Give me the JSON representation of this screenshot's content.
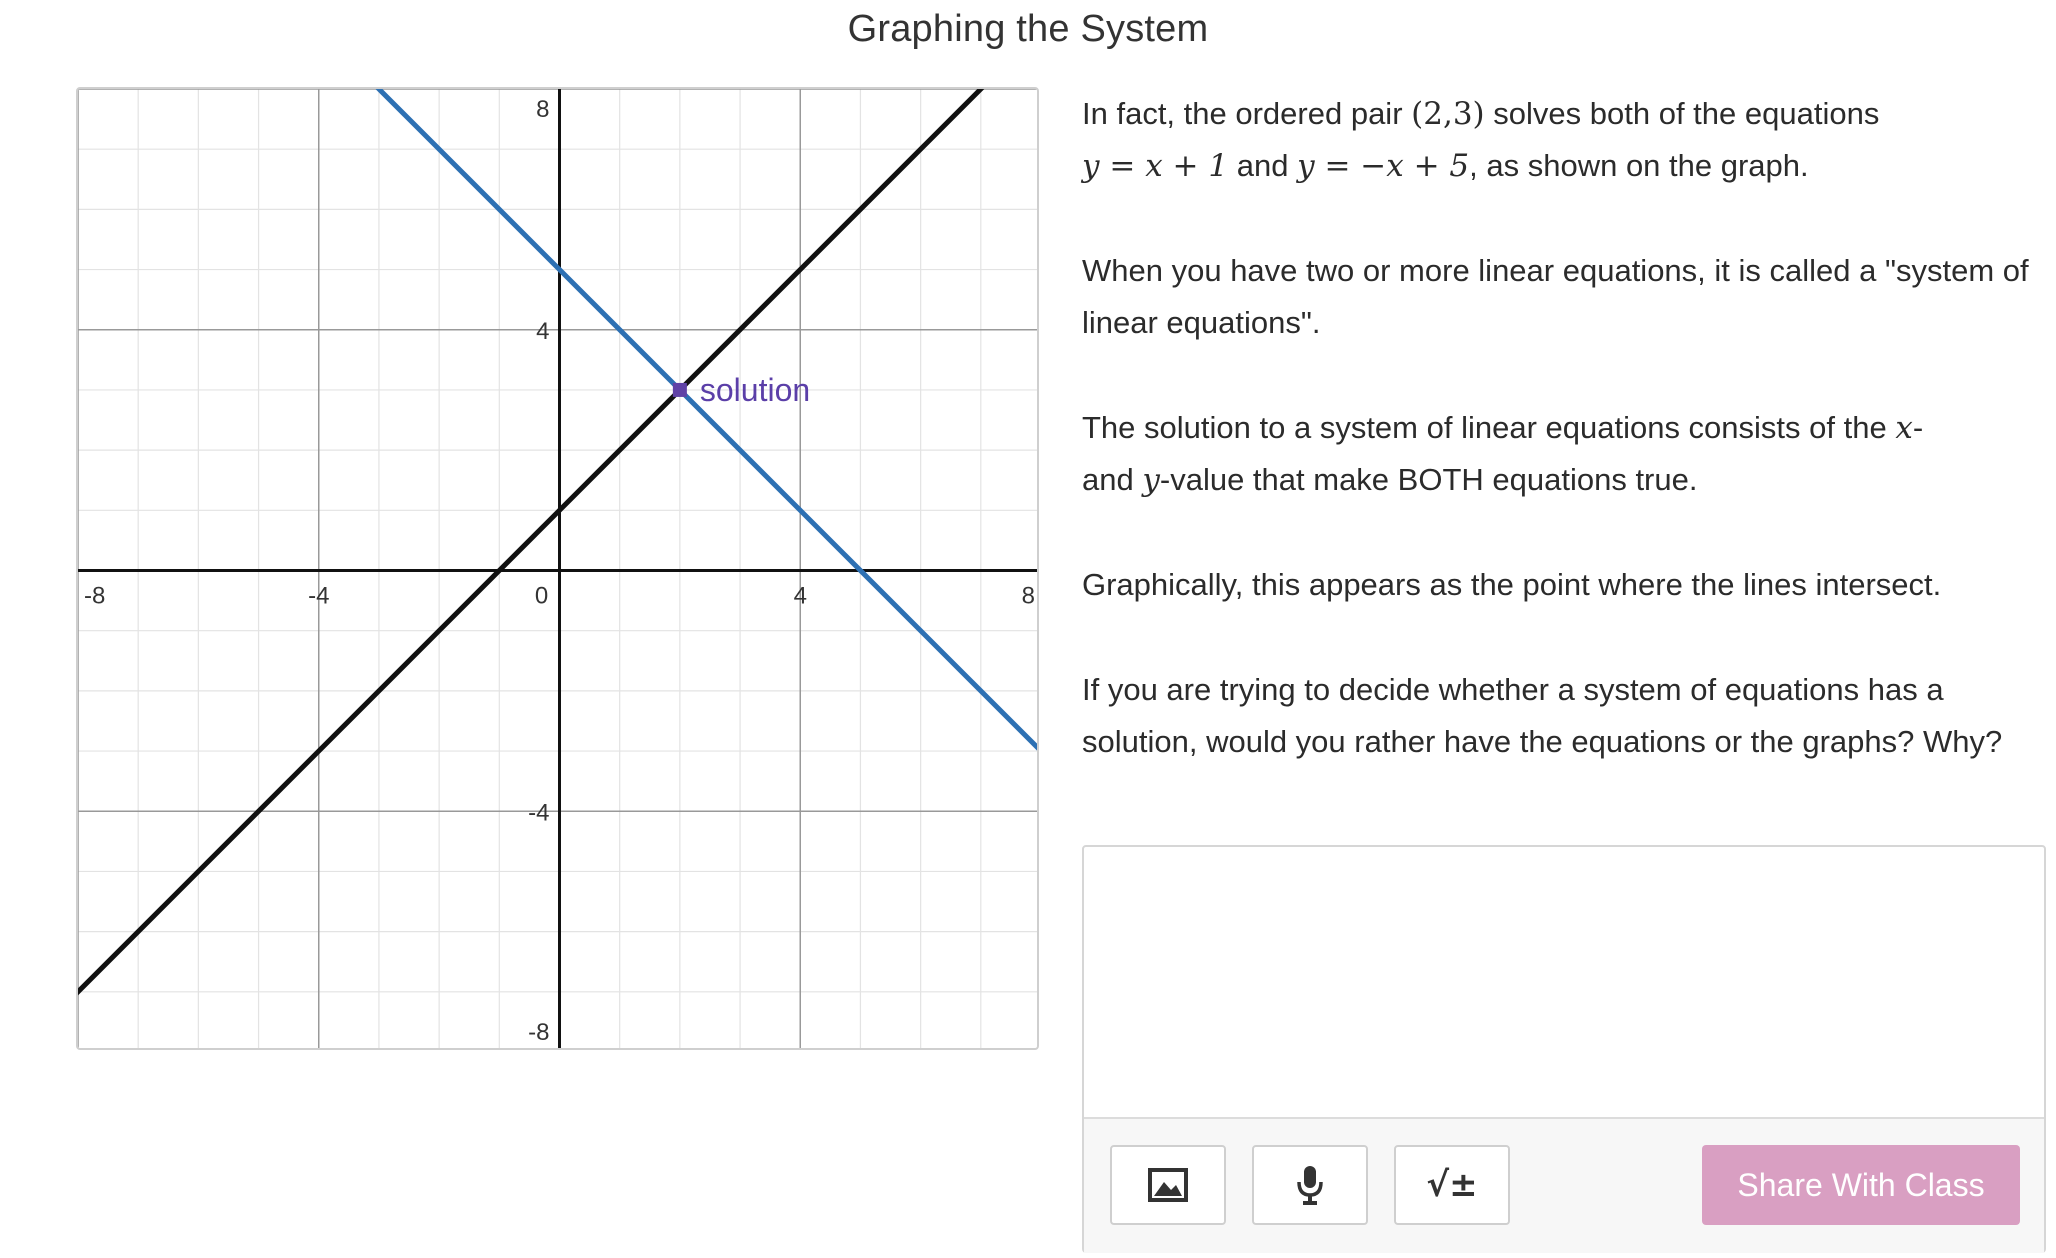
{
  "page": {
    "title": "Graphing the System"
  },
  "graph": {
    "x_range": [
      -8,
      8
    ],
    "y_range": [
      -8,
      8
    ],
    "minor_step": 1,
    "major_step": 4,
    "x_tick_labels": [
      "-8",
      "-4",
      "0",
      "4",
      "8"
    ],
    "y_tick_labels": [
      "8",
      "4",
      "-4",
      "-8"
    ],
    "lines": [
      {
        "name": "y = x + 1",
        "slope": 1,
        "intercept": 1,
        "color": "#111111"
      },
      {
        "name": "y = -x + 5",
        "slope": -1,
        "intercept": 5,
        "color": "#2d70b3"
      }
    ],
    "point": {
      "x": 2,
      "y": 3,
      "label": "solution",
      "color": "#6042a6"
    },
    "colors": {
      "minor_grid": "#e3e3e3",
      "major_grid": "#999999",
      "axis": "#111111"
    }
  },
  "content": {
    "p1_a": "In fact, the ordered pair",
    "p1_pair": "(2,3)",
    "p1_b": "solves both of the equations",
    "p1_eq1": "y = x + 1",
    "p1_and": "and",
    "p1_eq2": "y = −x + 5",
    "p1_c": ", as shown on the graph.",
    "p2": "When you have two or more linear equations, it is called a \"system of linear equations\".",
    "p3_a": "The solution to a system of linear equations consists of the",
    "p3_x": "x",
    "p3_b": "-",
    "p3_and": "and",
    "p3_y": "y",
    "p3_c": "-value that make BOTH equations true.",
    "p4": "Graphically, this appears as the point where the lines intersect.",
    "p5": "If you are trying to decide whether a system of equations has a solution, would you rather have the equations or the graphs? Why?"
  },
  "response": {
    "value": "",
    "placeholder": "",
    "share_label": "Share With Class",
    "math_tool_glyph": "√±",
    "share_color": "#d99fc2"
  },
  "icons": {
    "image": "image-icon",
    "mic": "microphone-icon",
    "math": "math-input-icon"
  }
}
